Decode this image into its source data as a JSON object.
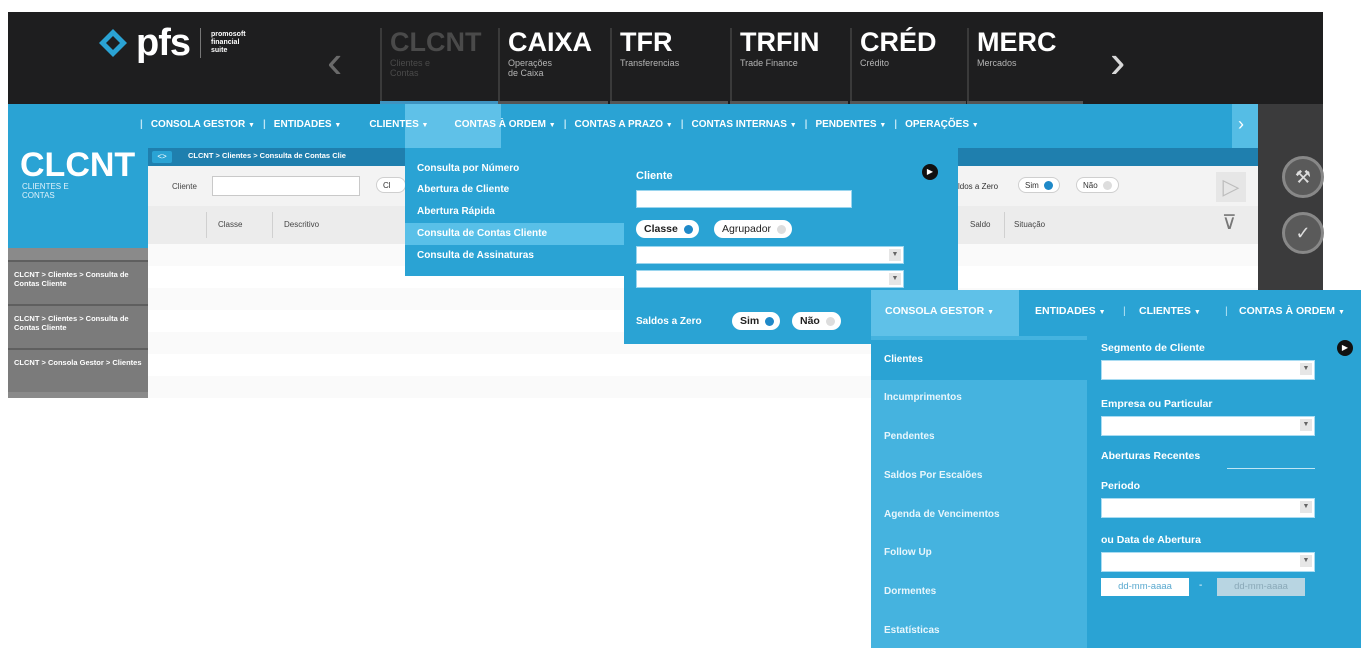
{
  "logo": {
    "name": "pfs",
    "suite": [
      "promosoft",
      "financial",
      "suite"
    ]
  },
  "modules": [
    {
      "code": "CLCNT",
      "sub": [
        "Clientes e",
        "Contas"
      ]
    },
    {
      "code": "CAIXA",
      "sub": [
        "Operações",
        "de Caixa"
      ]
    },
    {
      "code": "TFR",
      "sub": [
        "Transferencias"
      ]
    },
    {
      "code": "TRFIN",
      "sub": [
        "Trade Finance"
      ]
    },
    {
      "code": "CRÉD",
      "sub": [
        "Crédito"
      ]
    },
    {
      "code": "MERC",
      "sub": [
        "Mercados"
      ]
    }
  ],
  "nav": {
    "prev": "‹",
    "next": "›"
  },
  "menu": {
    "consola_gestor": "CONSOLA GESTOR",
    "entidades": "ENTIDADES",
    "clientes": "CLIENTES",
    "contas_ordem": "CONTAS À ORDEM",
    "contas_prazo": "CONTAS A PRAZO",
    "contas_internas": "CONTAS INTERNAS",
    "pendentes": "PENDENTES",
    "operacoes": "OPERAÇÕES",
    "caret": "▼",
    "separator": "|"
  },
  "left": {
    "title": "CLCNT",
    "subtitle": "CLIENTES E CONTAS",
    "history": [
      "CLCNT > Clientes > Consulta de Contas Cliente",
      "CLCNT > Clientes > Consulta de Contas Cliente",
      "CLCNT > Consola Gestor > Clientes"
    ]
  },
  "breadcrumb": {
    "toggle": "<>",
    "path": "CLCNT > Clientes > Consulta de Contas Clie"
  },
  "filter": {
    "cliente_label": "Cliente",
    "cl_short": "Cl",
    "saldos_label": "ldos a Zero",
    "sim": "Sim",
    "nao": "Não"
  },
  "columns": {
    "classe": "Classe",
    "descritivo": "Descritivo",
    "saldo": "Saldo",
    "situacao": "Situação"
  },
  "clientes_menu": [
    "Consulta por Número",
    "Abertura de Cliente",
    "Abertura Rápida",
    "Consulta de Contas Cliente",
    "Consulta de Assinaturas"
  ],
  "consulta_panel": {
    "cliente_label": "Cliente",
    "classe": "Classe",
    "agrupador": "Agrupador",
    "saldos_label": "Saldos a Zero",
    "sim": "Sim",
    "nao": "Não",
    "close": "▶"
  },
  "overlay": {
    "menu": {
      "consola_gestor": "CONSOLA GESTOR",
      "entidades": "ENTIDADES",
      "clientes": "CLIENTES",
      "contas_ordem": "CONTAS À ORDEM"
    },
    "items": [
      "Clientes",
      "Incumprimentos",
      "Pendentes",
      "Saldos Por Escalões",
      "Agenda de Vencimentos",
      "Follow Up",
      "Dormentes",
      "Estatísticas"
    ],
    "segmento": "Segmento de Cliente",
    "empresa": "Empresa ou Particular",
    "aberturas": "Aberturas Recentes",
    "periodo": "Periodo",
    "data_abertura": "ou Data de Abertura",
    "date_placeholder_1": "dd-mm-aaaa",
    "date_sep": "-",
    "date_placeholder_2": "dd-mm-aaaa",
    "close": "▶"
  },
  "colors": {
    "accent": "#2aa3d4",
    "dark": "#1e1e1f",
    "light_accent": "#5fc1e8"
  }
}
